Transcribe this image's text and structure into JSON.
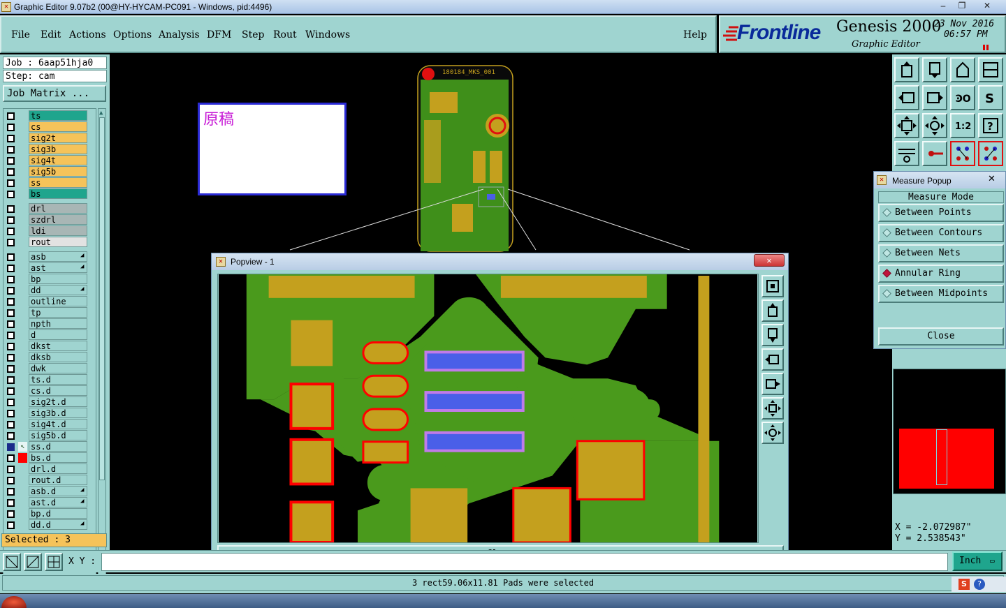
{
  "window": {
    "title": "Graphic Editor 9.07b2 (00@HY-HYCAM-PC091 - Windows, pid:4496)",
    "minimize": "–",
    "restore": "❐",
    "close": "✕"
  },
  "menu": {
    "items": [
      "File",
      "Edit",
      "Actions",
      "Options",
      "Analysis",
      "DFM",
      "Step",
      "Rout",
      "Windows"
    ],
    "help": "Help"
  },
  "brand": {
    "logo": "Frontline",
    "product": "Genesis 2000",
    "subtitle": "Graphic Editor",
    "date": "23 Nov 2016",
    "time": "06:57 PM"
  },
  "job": {
    "job_label": "Job : 6aap51hja0",
    "step_label": "Step: cam",
    "matrix_button": "Job Matrix ..."
  },
  "layers": [
    {
      "name": "ts",
      "color": "#1fa58d",
      "group": 1
    },
    {
      "name": "cs",
      "color": "#f5c35a",
      "group": 1
    },
    {
      "name": "sig2t",
      "color": "#f5c35a",
      "group": 1
    },
    {
      "name": "sig3b",
      "color": "#f5c35a",
      "group": 1
    },
    {
      "name": "sig4t",
      "color": "#f5c35a",
      "group": 1
    },
    {
      "name": "sig5b",
      "color": "#f5c35a",
      "group": 1
    },
    {
      "name": "ss",
      "color": "#f5c35a",
      "group": 1
    },
    {
      "name": "bs",
      "color": "#1fa58d",
      "group": 1
    },
    {
      "name": "drl",
      "color": "#a8b6b5",
      "group": 2
    },
    {
      "name": "szdrl",
      "color": "#a8b6b5",
      "group": 2
    },
    {
      "name": "ldi",
      "color": "#a8b6b5",
      "group": 2
    },
    {
      "name": "rout",
      "color": "#e2e2e2",
      "group": 2
    },
    {
      "name": "asb",
      "color": "#9fd4d0",
      "group": 3,
      "mark": "◢"
    },
    {
      "name": "ast",
      "color": "#9fd4d0",
      "group": 3,
      "mark": "◢"
    },
    {
      "name": "bp",
      "color": "#9fd4d0",
      "group": 3
    },
    {
      "name": "dd",
      "color": "#9fd4d0",
      "group": 3,
      "mark": "◢"
    },
    {
      "name": "outline",
      "color": "#9fd4d0",
      "group": 3
    },
    {
      "name": "tp",
      "color": "#9fd4d0",
      "group": 3
    },
    {
      "name": "npth",
      "color": "#9fd4d0",
      "group": 3
    },
    {
      "name": "d",
      "color": "#9fd4d0",
      "group": 3
    },
    {
      "name": "dkst",
      "color": "#9fd4d0",
      "group": 3
    },
    {
      "name": "dksb",
      "color": "#9fd4d0",
      "group": 3
    },
    {
      "name": "dwk",
      "color": "#9fd4d0",
      "group": 3
    },
    {
      "name": "ts.d",
      "color": "#9fd4d0",
      "group": 3
    },
    {
      "name": "cs.d",
      "color": "#9fd4d0",
      "group": 3
    },
    {
      "name": "sig2t.d",
      "color": "#9fd4d0",
      "group": 3
    },
    {
      "name": "sig3b.d",
      "color": "#9fd4d0",
      "group": 3
    },
    {
      "name": "sig4t.d",
      "color": "#9fd4d0",
      "group": 3
    },
    {
      "name": "sig5b.d",
      "color": "#9fd4d0",
      "group": 3
    },
    {
      "name": "ss.d",
      "color": "#9fd4d0",
      "group": 3,
      "active": true
    },
    {
      "name": "bs.d",
      "color": "#9fd4d0",
      "group": 3,
      "red": true
    },
    {
      "name": "drl.d",
      "color": "#9fd4d0",
      "group": 3
    },
    {
      "name": "rout.d",
      "color": "#9fd4d0",
      "group": 3
    },
    {
      "name": "asb.d",
      "color": "#9fd4d0",
      "group": 3,
      "mark": "◢"
    },
    {
      "name": "ast.d",
      "color": "#9fd4d0",
      "group": 3,
      "mark": "◢"
    },
    {
      "name": "bp.d",
      "color": "#9fd4d0",
      "group": 3
    },
    {
      "name": "dd.d",
      "color": "#9fd4d0",
      "group": 3,
      "mark": "◢"
    }
  ],
  "selected_label": "Selected : 3",
  "canvas": {
    "note_text": "原稿",
    "board_label": "180184_MKS_001"
  },
  "measure": {
    "title": "Measure Popup",
    "mode_label": "Measure Mode",
    "options": [
      "Between Points",
      "Between Contours",
      "Between Nets",
      "Annular Ring",
      "Between Midpoints"
    ],
    "selected": "Annular Ring",
    "close": "Close"
  },
  "popview": {
    "title": "Popview - 1",
    "close": "Close"
  },
  "coords": {
    "x": "X = -2.072987\"",
    "y": "Y = 2.538543\""
  },
  "cmd": {
    "xy_label": "X Y :",
    "xy_value": "",
    "units": "Inch"
  },
  "status": "3 rect59.06x11.81 Pads were selected",
  "colors": {
    "panel": "#9fd4d0",
    "copper": "#c4a01e",
    "green": "#4a9a1c",
    "selected_pad": "#4a5fe8",
    "highlight": "#ff0000"
  }
}
